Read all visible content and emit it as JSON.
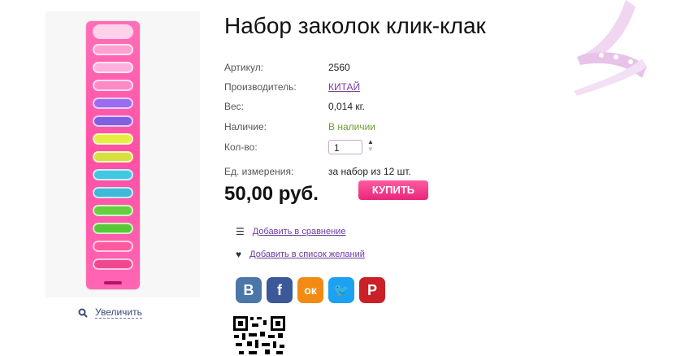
{
  "product": {
    "title": "Набор заколок клик-клак",
    "details": [
      {
        "label": "Артикул:",
        "value": "2560"
      },
      {
        "label": "Производитель:",
        "value": "КИТАЙ"
      },
      {
        "label": "Вес:",
        "value": "0,014 кг."
      },
      {
        "label": "Наличие:",
        "value": "В наличии"
      },
      {
        "label": "Кол-во:",
        "value": ""
      },
      {
        "label": "Ед. измерения:",
        "value": "за набор из 12 шт."
      }
    ],
    "quantity": "1",
    "price": "50,00 руб.",
    "buy_label": "КУПИТЬ"
  },
  "image": {
    "zoom_label": "Увеличить"
  },
  "actions": {
    "compare": "Добавить в сравнение",
    "wishlist": " Добавить в список желаний"
  },
  "social": [
    {
      "name": "vk",
      "glyph": "В",
      "color": "#4a76a8"
    },
    {
      "name": "facebook",
      "glyph": "f",
      "color": "#3b5998"
    },
    {
      "name": "odnoklassniki",
      "glyph": "ок",
      "color": "#f28a13"
    },
    {
      "name": "twitter",
      "glyph": "🐦",
      "color": "#1da1f2"
    },
    {
      "name": "pinterest",
      "glyph": "P",
      "color": "#cb2027"
    }
  ],
  "colors": {
    "accent": "#e8267c",
    "link": "#7a3ea0",
    "in_stock": "#6aa02a"
  }
}
